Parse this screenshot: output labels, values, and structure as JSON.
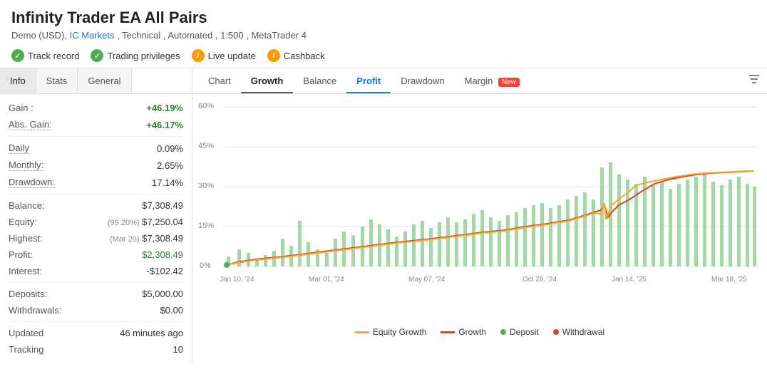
{
  "header": {
    "title": "Infinity Trader EA All Pairs",
    "subtitle_prefix": "Demo (USD), ",
    "broker": "IC Markets",
    "subtitle_suffix": " , Technical , Automated , 1:500 , MetaTrader 4"
  },
  "badges": [
    {
      "id": "track-record",
      "icon": "check",
      "type": "green",
      "label": "Track record"
    },
    {
      "id": "trading-privileges",
      "icon": "check",
      "type": "green",
      "label": "Trading privileges"
    },
    {
      "id": "live-update",
      "icon": "info",
      "type": "info",
      "label": "Live update"
    },
    {
      "id": "cashback",
      "icon": "info",
      "type": "info",
      "label": "Cashback"
    }
  ],
  "left_tabs": [
    {
      "id": "info",
      "label": "Info",
      "active": true
    },
    {
      "id": "stats",
      "label": "Stats",
      "active": false
    },
    {
      "id": "general",
      "label": "General",
      "active": false
    }
  ],
  "stats": {
    "gain_label": "Gain :",
    "gain_value": "+46.19%",
    "abs_gain_label": "Abs. Gain:",
    "abs_gain_value": "+46.17%",
    "daily_label": "Daily",
    "daily_value": "0.09%",
    "monthly_label": "Monthly:",
    "monthly_value": "2.65%",
    "drawdown_label": "Drawdown:",
    "drawdown_value": "17.14%",
    "balance_label": "Balance:",
    "balance_value": "$7,308.49",
    "equity_label": "Equity:",
    "equity_note": "(99.20%)",
    "equity_value": "$7,250.04",
    "highest_label": "Highest:",
    "highest_note": "(Mar 20)",
    "highest_value": "$7,308.49",
    "profit_label": "Profit:",
    "profit_value": "$2,308.49",
    "interest_label": "Interest:",
    "interest_value": "-$102.42",
    "deposits_label": "Deposits:",
    "deposits_value": "$5,000.00",
    "withdrawals_label": "Withdrawals:",
    "withdrawals_value": "$0.00",
    "updated_label": "Updated",
    "updated_value": "46 minutes ago",
    "tracking_label": "Tracking",
    "tracking_value": "10"
  },
  "right_tabs": [
    {
      "id": "chart",
      "label": "Chart",
      "active": false
    },
    {
      "id": "growth",
      "label": "Growth",
      "active": true
    },
    {
      "id": "balance",
      "label": "Balance",
      "active": false
    },
    {
      "id": "profit",
      "label": "Profit",
      "active": false,
      "highlight": true
    },
    {
      "id": "drawdown",
      "label": "Drawdown",
      "active": false
    },
    {
      "id": "margin",
      "label": "Margin",
      "active": false,
      "new_badge": true
    }
  ],
  "chart": {
    "y_labels": [
      "60%",
      "45%",
      "30%",
      "15%",
      "0%"
    ],
    "x_labels": [
      "Jan 10, '24",
      "Mar 01, '24",
      "May 07, '24",
      "Oct 28, '24",
      "Jan 14, '25",
      "Mar 18, '25"
    ],
    "start_dot_pct": 0
  },
  "legend": [
    {
      "id": "equity-growth",
      "label": "Equity Growth",
      "color": "#f0c040",
      "type": "line"
    },
    {
      "id": "growth",
      "label": "Growth",
      "color": "#e53935",
      "type": "line"
    },
    {
      "id": "deposit",
      "label": "Deposit",
      "color": "#4caf50",
      "type": "dot"
    },
    {
      "id": "withdrawal",
      "label": "Withdrawal",
      "color": "#e53935",
      "type": "dot"
    }
  ],
  "colors": {
    "green": "#2e7d32",
    "red": "#c62828",
    "profit_green": "#2e7d32",
    "tab_active_underline": "#555",
    "bar_green": "#a5d6a7",
    "line_growth": "#e53935",
    "line_equity": "#f9a825"
  }
}
